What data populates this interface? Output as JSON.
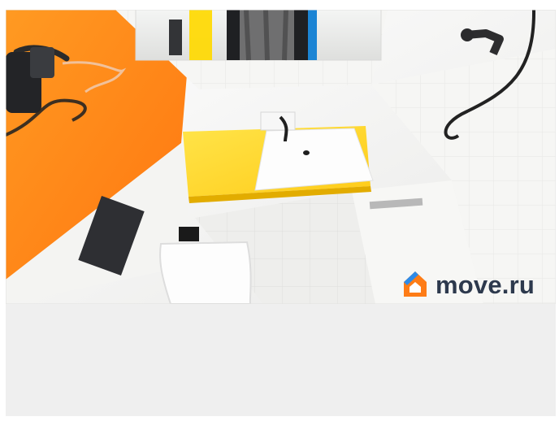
{
  "image": {
    "watermark": {
      "text": "move.ru",
      "icon": "house-logo-icon",
      "colors": {
        "orange": "#ff7a12",
        "blue": "#2b89e8",
        "text": "#29364a"
      }
    },
    "colors": {
      "bottom_panel": "#efefef",
      "wall_tiles": "#f3f3f1",
      "orange_wall": "#ff8a1a",
      "yellow_counter": "#ffd21f"
    }
  }
}
